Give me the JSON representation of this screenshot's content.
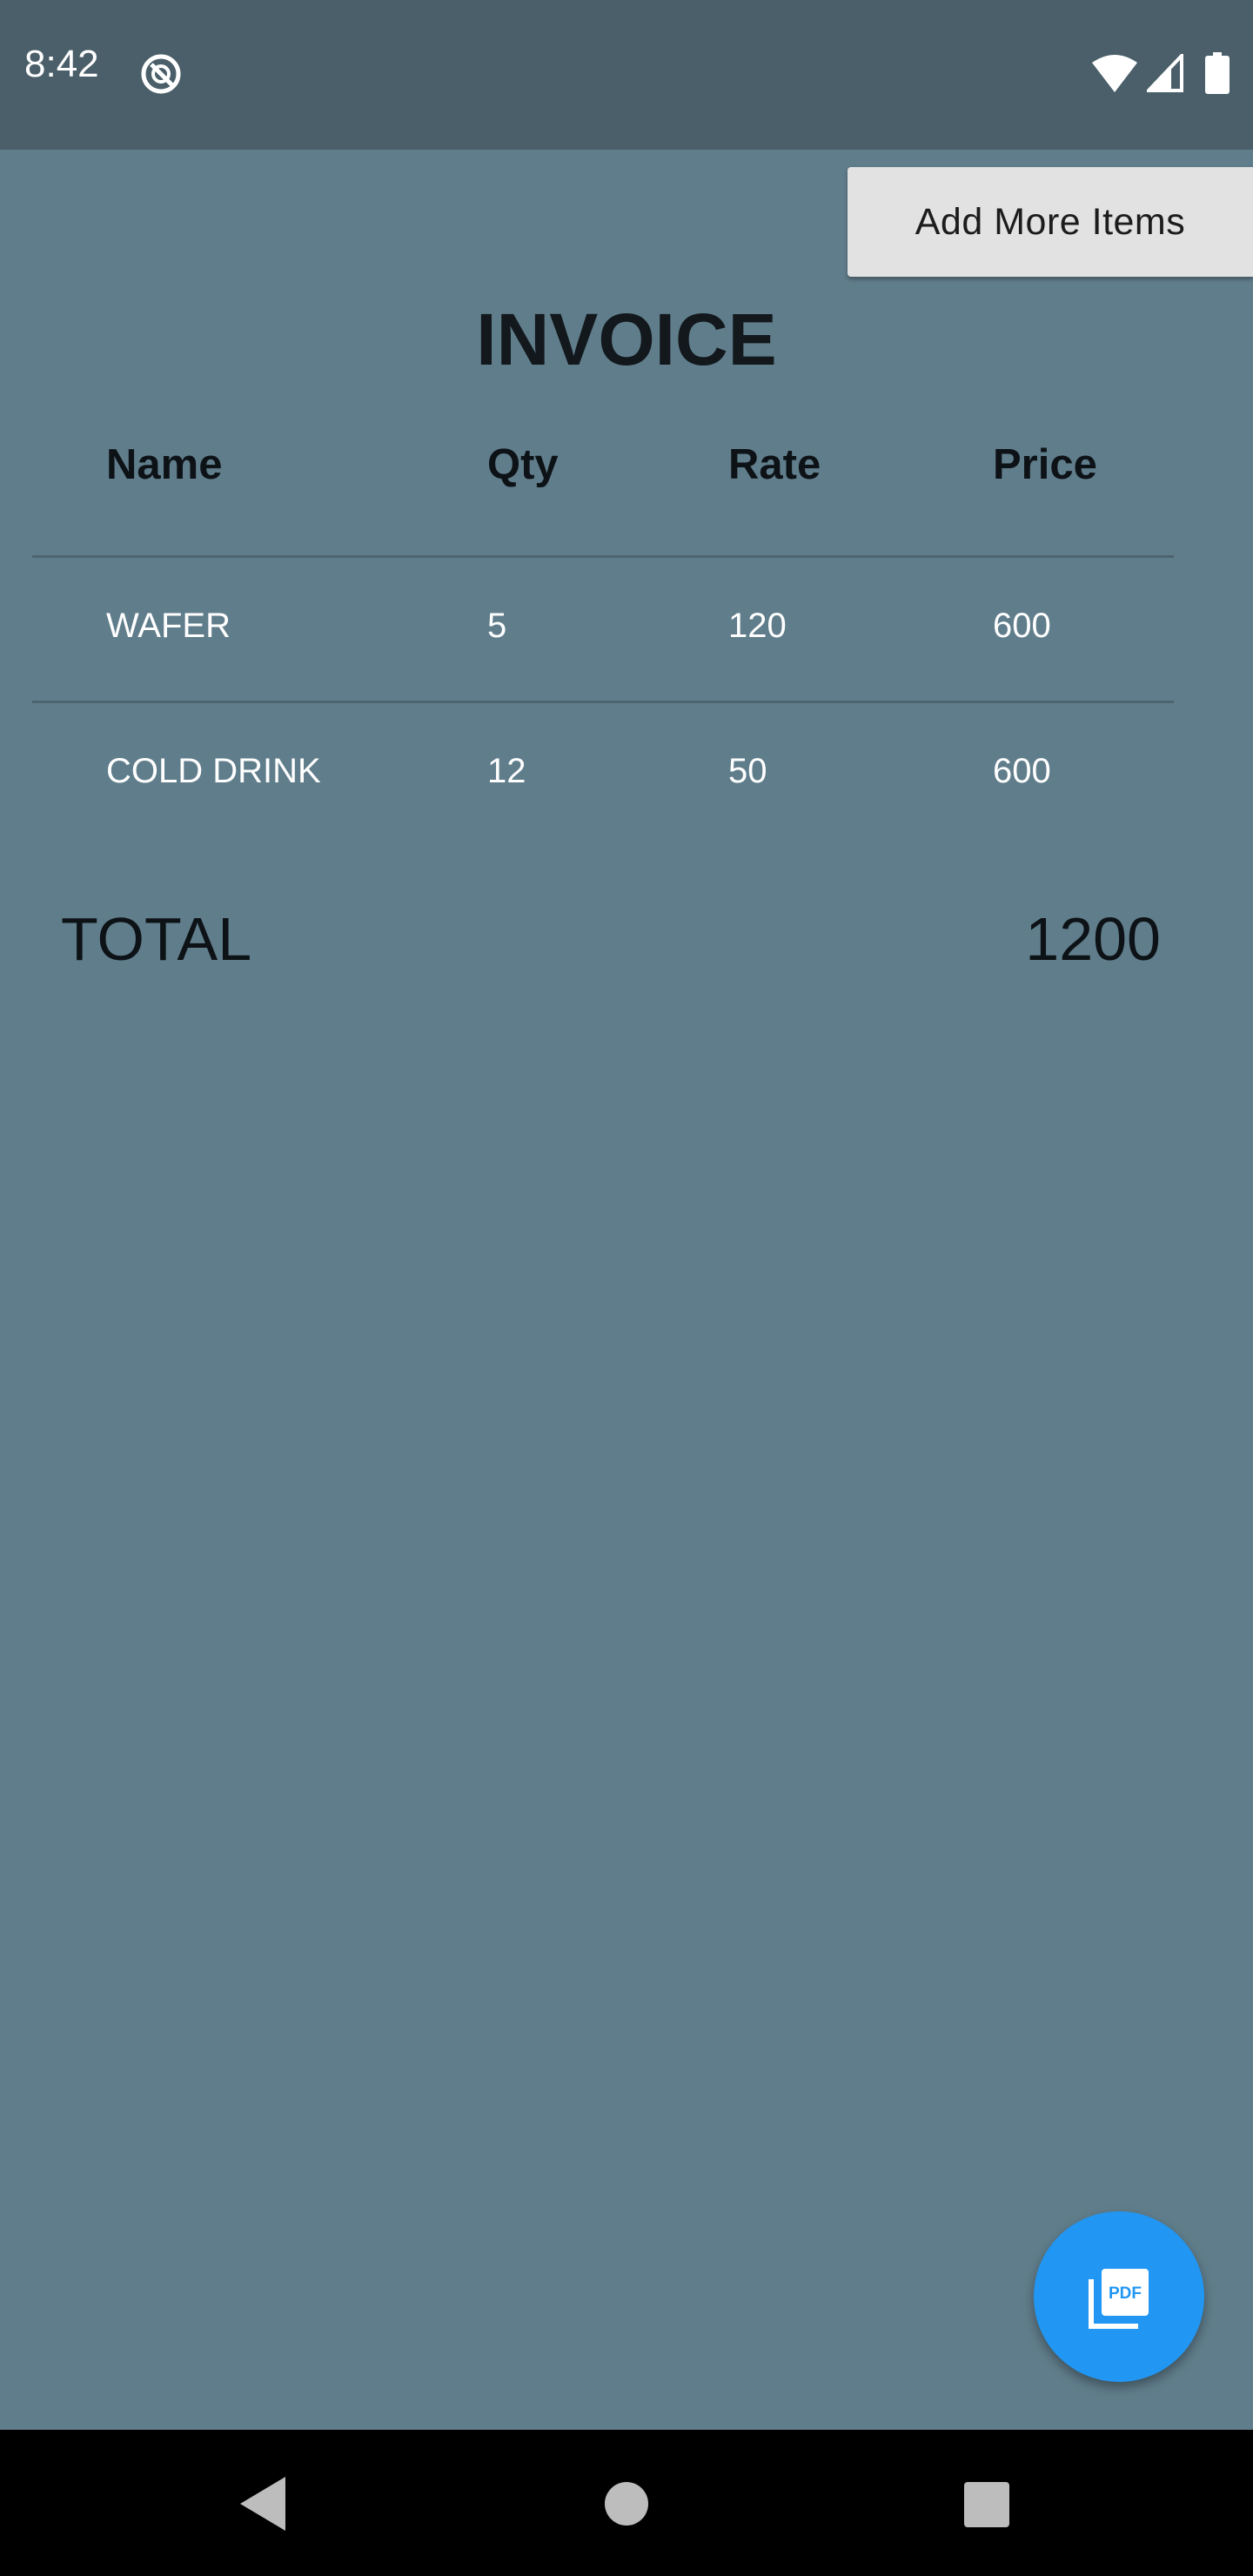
{
  "status_bar": {
    "time": "8:42",
    "icons": [
      "app-notification-icon",
      "wifi-icon",
      "cell-signal-icon",
      "battery-icon"
    ]
  },
  "toolbar": {
    "add_items_label": "Add More Items"
  },
  "invoice": {
    "title": "INVOICE",
    "columns": [
      "Name",
      "Qty",
      "Rate",
      "Price"
    ],
    "rows": [
      {
        "name": "WAFER",
        "qty": "5",
        "rate": "120",
        "price": "600"
      },
      {
        "name": "COLD DRINK",
        "qty": "12",
        "rate": "50",
        "price": "600"
      }
    ],
    "total_label": "TOTAL",
    "total_value": "1200"
  },
  "fab": {
    "icon": "pdf-icon",
    "color": "#2196f3"
  },
  "nav_bar": {
    "icons": [
      "back-icon",
      "home-icon",
      "recents-icon"
    ]
  },
  "colors": {
    "background": "#607d8b",
    "status_bar": "#4a5f69",
    "button": "#e2e2e2",
    "accent": "#2196f3"
  }
}
